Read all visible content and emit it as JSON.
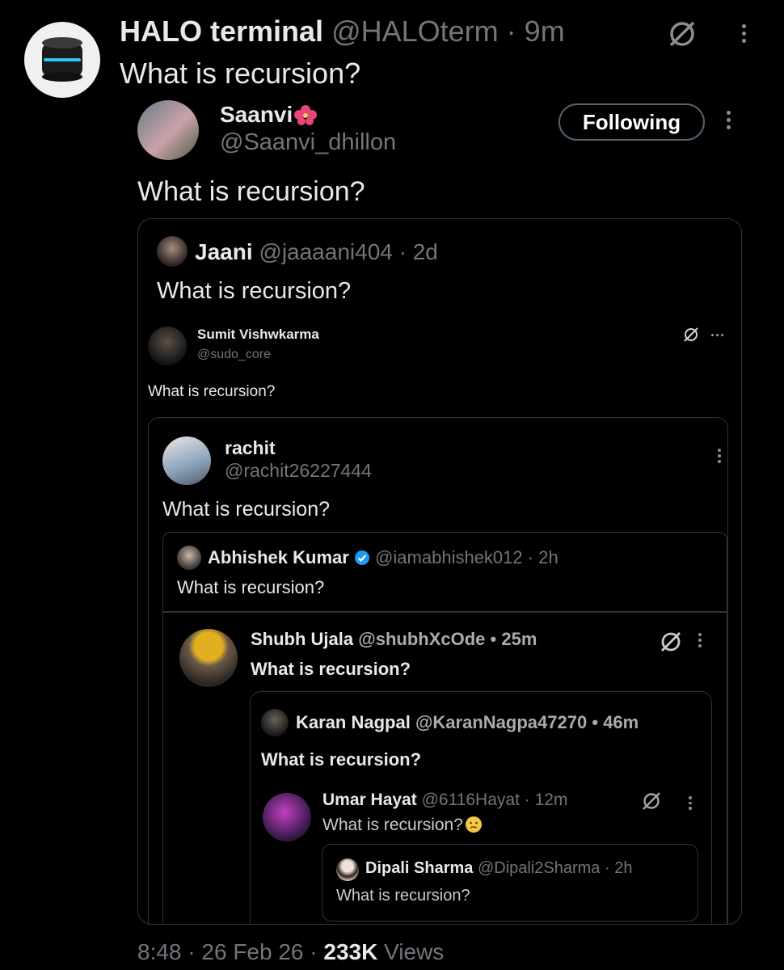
{
  "main_post": {
    "name": "HALO terminal",
    "handle": "@HALOterm",
    "time": "9m",
    "text": "What is recursion?"
  },
  "q1": {
    "name": "Saanvi",
    "handle": "@Saanvi_dhillon",
    "follow_label": "Following",
    "text": "What is recursion?"
  },
  "q2": {
    "name": "Jaani",
    "handle": "@jaaaani404",
    "time": "2d",
    "text": "What is recursion?"
  },
  "q3": {
    "name": "Sumit Vishwkarma",
    "handle": "@sudo_core",
    "text": "What is recursion?"
  },
  "q4": {
    "name": "rachit",
    "handle": "@rachit26227444",
    "text": "What is recursion?"
  },
  "q5": {
    "name": "Abhishek Kumar",
    "handle": "@iamabhishek012",
    "time": "2h",
    "text": "What is recursion?"
  },
  "q6": {
    "name": "Shubh Ujala",
    "handle": "@shubhXcOde",
    "time": "25m",
    "text": "What is recursion?"
  },
  "q7": {
    "name": "Karan Nagpal",
    "handle": "@KaranNagpa47270",
    "time": "46m",
    "text": "What is recursion?"
  },
  "q8": {
    "name": "Umar Hayat",
    "handle": "@6116Hayat",
    "time": "12m",
    "text": "What is recursion?"
  },
  "q9": {
    "name": "Dipali Sharma",
    "handle": "@Dipali2Sharma",
    "time": "2h",
    "text": "What is recursion?"
  },
  "footer": {
    "time": "8:48",
    "date": "26 Feb 26",
    "views_count": "233K",
    "views_label": "Views"
  },
  "separator": "·",
  "colors": {
    "background": "#000000",
    "text": "#e7e9ea",
    "muted": "#71767b",
    "border": "#2f3336",
    "verified": "#1d9bf0"
  },
  "icons": [
    "grok-icon",
    "more-vertical-icon",
    "more-horizontal-icon",
    "verified-badge-icon",
    "hibiscus-emoji",
    "thinking-emoji"
  ]
}
